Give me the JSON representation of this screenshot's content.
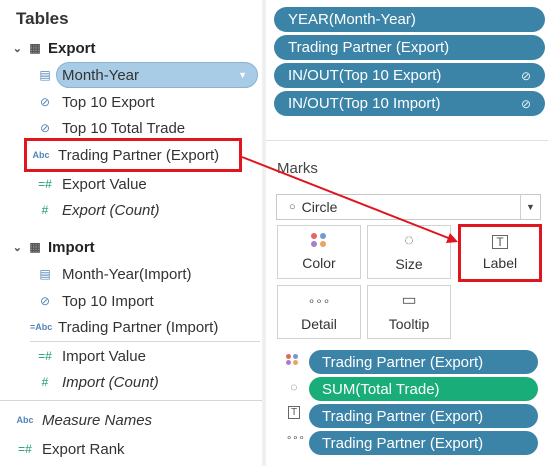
{
  "left_pane": {
    "title": "Tables",
    "export_group": {
      "name": "Export",
      "fields": [
        {
          "label": "Month-Year",
          "icon": "calendar-icon"
        },
        {
          "label": "Top 10 Export",
          "icon": "set-icon"
        },
        {
          "label": "Top 10 Total Trade",
          "icon": "set-icon"
        },
        {
          "label": "Trading Partner (Export)",
          "icon": "Abc"
        },
        {
          "label": "Export Value",
          "icon": "=#"
        },
        {
          "label": "Export (Count)",
          "icon": "#"
        }
      ]
    },
    "import_group": {
      "name": "Import",
      "fields": [
        {
          "label": "Month-Year(Import)",
          "icon": "calendar-icon"
        },
        {
          "label": "Top 10 Import",
          "icon": "set-icon"
        },
        {
          "label": "Trading Partner (Import)",
          "icon": "=Abc"
        },
        {
          "label": "Import Value",
          "icon": "=#"
        },
        {
          "label": "Import (Count)",
          "icon": "#"
        }
      ]
    },
    "other_fields": [
      {
        "label": "Measure Names",
        "icon": "Abc"
      },
      {
        "label": "Export Rank",
        "icon": "=#"
      }
    ]
  },
  "columns_pills": [
    {
      "label": "YEAR(Month-Year)"
    },
    {
      "label": "Trading Partner (Export)"
    },
    {
      "label": "IN/OUT(Top 10 Export)"
    },
    {
      "label": "IN/OUT(Top 10 Import)"
    }
  ],
  "marks": {
    "title": "Marks",
    "mark_type": "Circle",
    "buttons": {
      "color": "Color",
      "size": "Size",
      "label": "Label",
      "detail": "Detail",
      "tooltip": "Tooltip"
    },
    "shelf": [
      {
        "label": "Trading Partner (Export)",
        "icon": "color-dots-icon",
        "color": "#3b84a8"
      },
      {
        "label": "SUM(Total Trade)",
        "icon": "size-icon",
        "color": "#19ad79"
      },
      {
        "label": "Trading Partner (Export)",
        "icon": "label-icon",
        "color": "#3b84a8"
      },
      {
        "label": "Trading Partner (Export)",
        "icon": "detail-icon",
        "color": "#3b84a8"
      }
    ]
  },
  "colors": {
    "pill_blue": "#3b84a8",
    "pill_green": "#19ad79",
    "highlight_red": "#e0151e",
    "selected_pill": "#a8cce6"
  }
}
